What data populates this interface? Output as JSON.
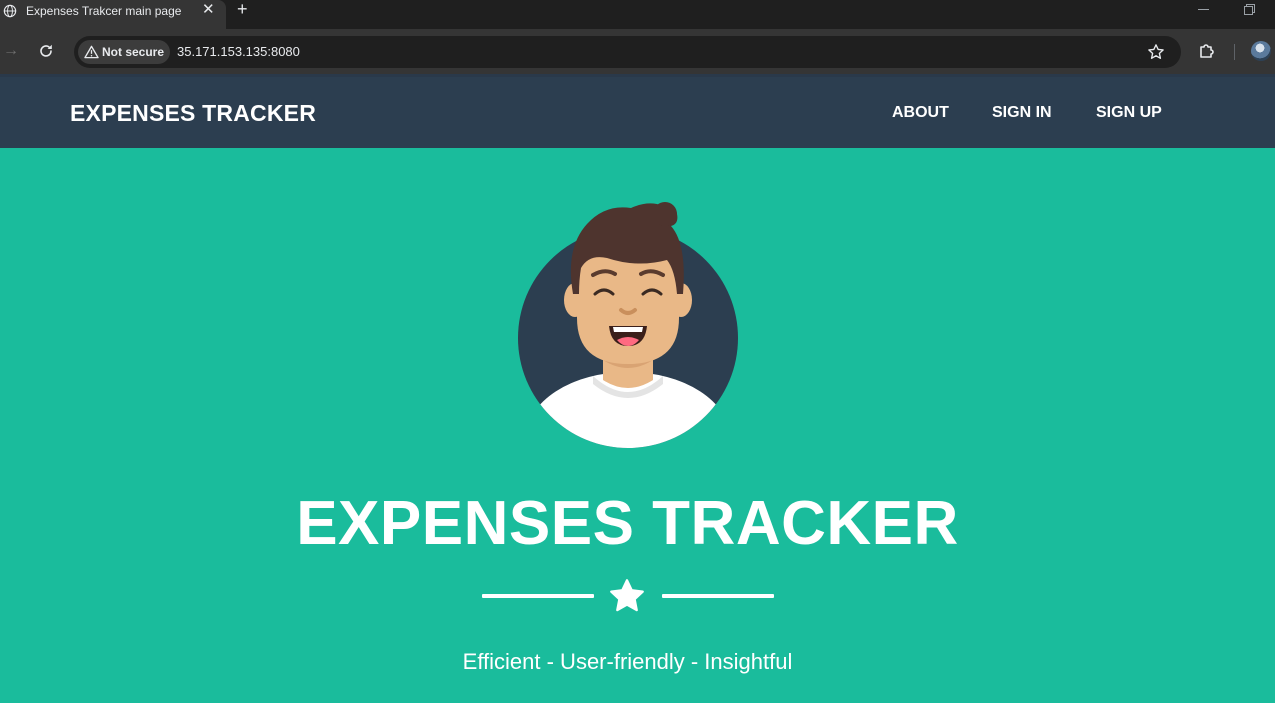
{
  "browser": {
    "tab_title": "Expenses Trakcer main page",
    "security_label": "Not secure",
    "url": "35.171.153.135:8080"
  },
  "navbar": {
    "brand": "EXPENSES TRACKER",
    "links": [
      "ABOUT",
      "SIGN IN",
      "SIGN UP"
    ]
  },
  "masthead": {
    "heading": "EXPENSES TRACKER",
    "tagline": "Efficient - User-friendly - Insightful"
  },
  "colors": {
    "page_background": "#1abc9c",
    "navbar_background": "#2c3e50",
    "text": "#ffffff"
  },
  "icons": {
    "divider": "star-icon",
    "avatar": "smiling-person-avatar"
  }
}
